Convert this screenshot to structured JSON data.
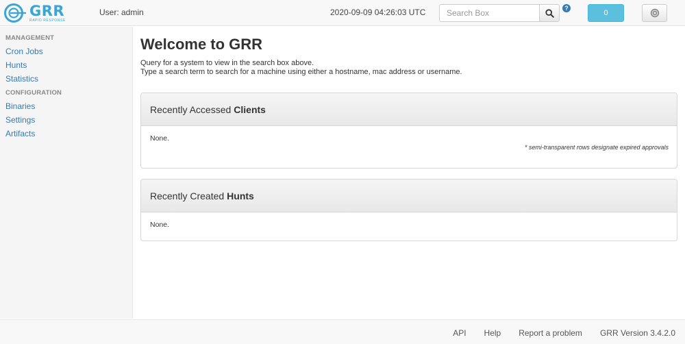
{
  "header": {
    "logo_word": "GRR",
    "logo_tagline": "RAPID RESPONSE",
    "user_label": "User: admin",
    "timestamp": "2020-09-09 04:26:03 UTC",
    "search": {
      "placeholder": "Search Box",
      "value": ""
    },
    "help_badge": "?",
    "notification_count": "0",
    "brand_color": "#3aa5d6",
    "icons": [
      "search-icon",
      "help-icon",
      "gear-icon"
    ]
  },
  "sidebar": {
    "sections": [
      {
        "title": "MANAGEMENT",
        "items": [
          "Cron Jobs",
          "Hunts",
          "Statistics"
        ]
      },
      {
        "title": "CONFIGURATION",
        "items": [
          "Binaries",
          "Settings",
          "Artifacts"
        ]
      }
    ]
  },
  "main": {
    "title": "Welcome to GRR",
    "intro_lines": [
      "Query for a system to view in the search box above.",
      "Type a search term to search for a machine using either a hostname, mac address or username."
    ],
    "panels": [
      {
        "heading_prefix": "Recently Accessed",
        "heading_strong": "Clients",
        "body": "None.",
        "note": "* semi-transparent rows designate expired approvals"
      },
      {
        "heading_prefix": "Recently Created",
        "heading_strong": "Hunts",
        "body": "None."
      }
    ]
  },
  "footer": {
    "links": [
      "API",
      "Help",
      "Report a problem"
    ],
    "version": "GRR Version 3.4.2.0"
  }
}
